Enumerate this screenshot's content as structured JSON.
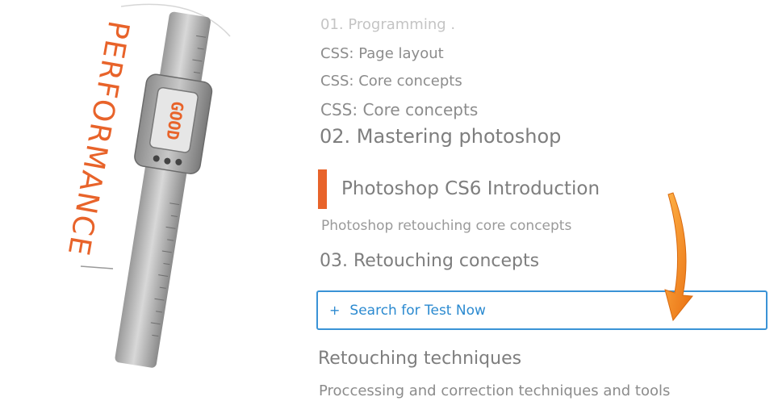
{
  "illustration": {
    "vertical_word": "PERFORMANCE",
    "display_text": "GOOD",
    "accent_color": "#e8632a"
  },
  "menu": {
    "section1_heading": "01. Programming .",
    "section1_items": [
      "CSS: Page layout",
      "CSS: Core concepts",
      "CSS: Core concepts"
    ],
    "section2_heading": "02. Mastering photoshop",
    "active_item": "Photoshop CS6 Introduction",
    "section2_sub": "Photoshop retouching core concepts",
    "section3_heading": "03. Retouching concepts",
    "search_button_icon": "plus-icon",
    "search_button_label": "Search for Test Now",
    "section4_heading": "Retouching techniques",
    "section4_sub": "Proccessing and correction techniques and tools"
  },
  "colors": {
    "accent": "#e8632a",
    "button_blue": "#3a93d6",
    "arrow_orange": "#f08a1c"
  }
}
